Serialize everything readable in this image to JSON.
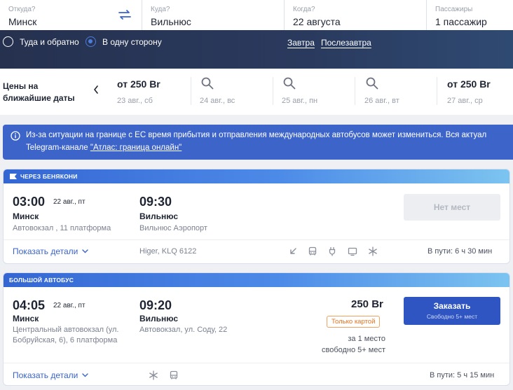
{
  "search": {
    "from_label": "Откуда?",
    "from_value": "Минск",
    "to_label": "Куда?",
    "to_value": "Вильнюс",
    "date_label": "Когда?",
    "date_value": "22 августа",
    "pass_label": "Пассажиры",
    "pass_value": "1 пассажир",
    "roundtrip_label": "Туда и обратно",
    "oneway_label": "В одну сторону",
    "tomorrow_label": "Завтра",
    "dayafter_label": "Послезавтра"
  },
  "dates": {
    "title_line1": "Цены на",
    "title_line2": "ближайшие даты",
    "days": [
      {
        "price": "от 250 Br",
        "label": "23 авг., сб"
      },
      {
        "price": "",
        "label": "24 авг., вс"
      },
      {
        "price": "",
        "label": "25 авг., пн"
      },
      {
        "price": "",
        "label": "26 авг., вт"
      },
      {
        "price": "от 250 Br",
        "label": "27 авг., ср"
      }
    ]
  },
  "notice": {
    "line1": "Из-за ситуации на границе с ЕС время прибытия и отправления международных автобусов может измениться. Вся актуал",
    "line2_prefix": "Telegram-канале ",
    "link": "\"Атлас: граница онлайн\""
  },
  "trips": [
    {
      "ribbon": "ЧЕРЕЗ БЕНЯКОНИ",
      "dep_time": "03:00",
      "dep_date": "22 авг., пт",
      "dep_city": "Минск",
      "dep_station_1": "Автовокзал , 11 платформа",
      "dep_station_2": "",
      "arr_time": "09:30",
      "arr_city": "Вильнюс",
      "arr_station": "Вильнюс Аэропорт",
      "button": "Нет мест",
      "details": "Показать детали",
      "bus": "Higer, KLQ 6122",
      "duration": "В пути: 6 ч 30 мин",
      "amenities": [
        "recline-icon",
        "bus-icon",
        "socket-icon",
        "tv-icon",
        "snowflake-icon"
      ]
    },
    {
      "ribbon": "БОЛЬШОЙ АВТОБУС",
      "dep_time": "04:05",
      "dep_date": "22 авг., пт",
      "dep_city": "Минск",
      "dep_station_1": "Центральный автовокзал (ул.",
      "dep_station_2": "Бобруйская, 6), 6 платформа",
      "arr_time": "09:20",
      "arr_city": "Вильнюс",
      "arr_station": "Автовокзал, ул. Соду, 22",
      "price": "250 Br",
      "badge": "Только картой",
      "seat_1": "за 1 место",
      "seat_2": "свободно 5+ мест",
      "button": "Заказать",
      "button_sub": "Свободно 5+ мест",
      "details": "Показать детали",
      "duration": "В пути: 5 ч 15 мин",
      "amenities": [
        "snowflake-icon",
        "bus-icon"
      ]
    }
  ],
  "colors": {
    "accent": "#3d64c9",
    "header": "#2a3a5e",
    "badge": "#e2711c"
  }
}
